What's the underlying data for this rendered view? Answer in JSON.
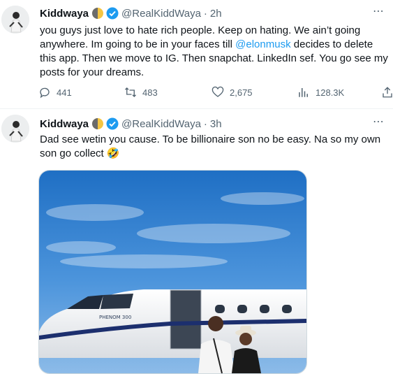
{
  "tweets": [
    {
      "author": "Kiddwaya",
      "handle": "@RealKiddWaya",
      "time": "2h",
      "text_before": "you guys just love to hate rich people. Keep on hating. We ain’t going anywhere. Im going to be in your faces till ",
      "mention": "@elonmusk",
      "text_after": " decides to delete this app. Then we move to IG. Then snapchat. LinkedIn sef. You go see my posts for your dreams.",
      "replies": "441",
      "retweets": "483",
      "likes": "2,675",
      "views": "128.3K"
    },
    {
      "author": "Kiddwaya",
      "handle": "@RealKiddWaya",
      "time": "3h",
      "text": "Dad see wetin you cause. To be billionaire son no be easy. Na so my own son go collect 🤣",
      "jet_livery": "PHENOM 300"
    }
  ],
  "icons": [
    "avatar",
    "moon-emoji-icon",
    "verified-badge-icon",
    "more-icon",
    "reply-icon",
    "retweet-icon",
    "like-icon",
    "views-icon",
    "share-icon"
  ],
  "colors": {
    "accent": "#1d9bf0",
    "secondary_text": "#536471",
    "divider": "#eff3f4"
  }
}
